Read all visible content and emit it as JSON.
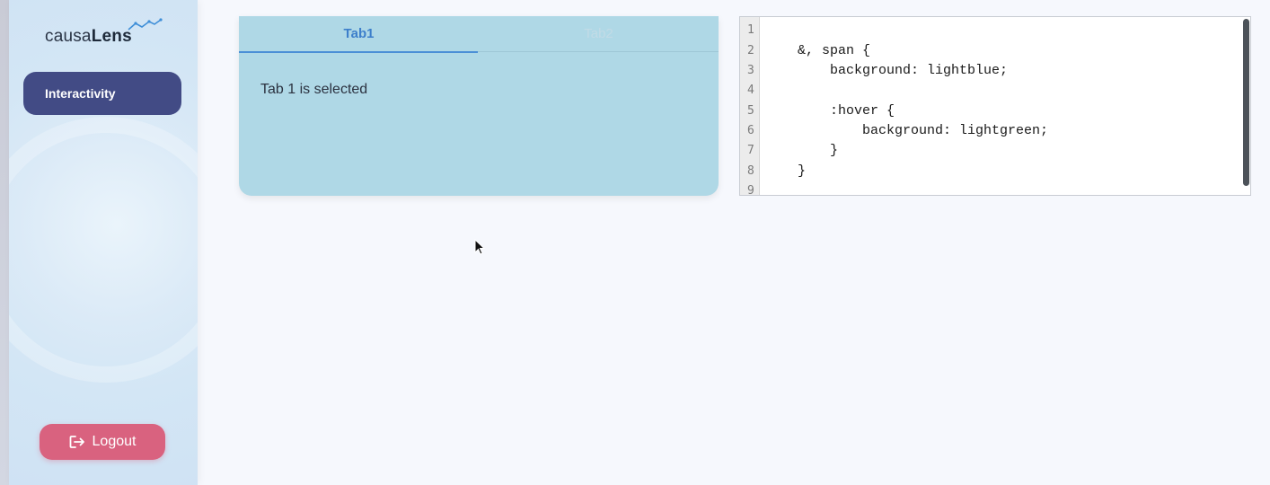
{
  "sidebar": {
    "logo": {
      "prefix": "causa",
      "suffix": "Lens"
    },
    "nav": [
      {
        "label": "Interactivity"
      }
    ],
    "logout_label": "Logout"
  },
  "tabs": {
    "items": [
      {
        "label": "Tab1",
        "selected": true
      },
      {
        "label": "Tab2",
        "selected": false
      }
    ],
    "content": "Tab 1 is selected"
  },
  "editor": {
    "line_numbers": [
      "1",
      "2",
      "3",
      "4",
      "5",
      "6",
      "7",
      "8",
      "9"
    ],
    "lines": [
      "",
      "&, span {",
      "    background: lightblue;",
      "",
      "    :hover {",
      "        background: lightgreen;",
      "    }",
      "}",
      ""
    ]
  },
  "colors": {
    "nav_active": "#424b85",
    "logout": "#d9627f",
    "tab_selected": "#3d7fcb",
    "tabs_bg": "#afd8e6"
  },
  "icons": [
    "spark-line-icon",
    "logout-icon",
    "mouse-cursor-icon"
  ]
}
